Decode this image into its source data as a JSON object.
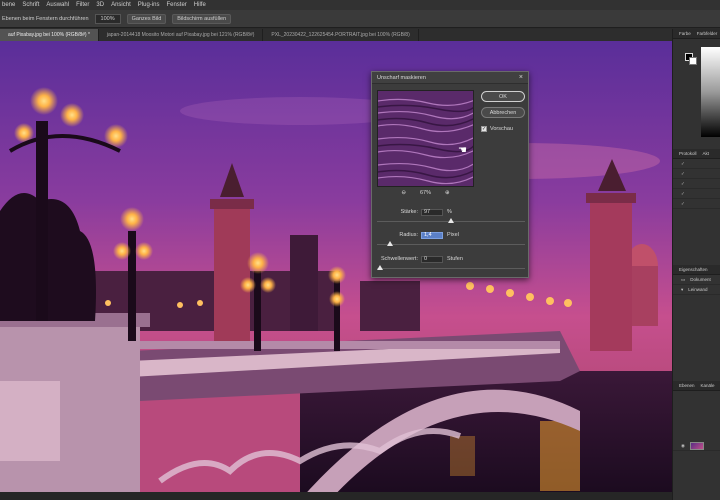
{
  "menubar": {
    "items": [
      "bene",
      "Schrift",
      "Auswahl",
      "Filter",
      "3D",
      "Ansicht",
      "Plug-ins",
      "Fenster",
      "Hilfe"
    ]
  },
  "options_bar": {
    "align_label": "Ebenen beim Fenstern durchführen",
    "zoom_value": "100%",
    "fit_button": "Ganzes Bild",
    "fill_button": "Bildschirm ausfüllen"
  },
  "tabs": [
    {
      "label": "auf Pixabay.jpg bei 100% (RGB/8#) *",
      "active": true
    },
    {
      "label": "japan-2014418 Moosito Motori auf Pixabay.jpg bei 121% (RGB/8#)",
      "active": false
    },
    {
      "label": "PXL_20230422_122625454.PORTRAIT.jpg bei 100% (RGB/8)",
      "active": false
    }
  ],
  "dialog": {
    "title": "Unscharf maskieren",
    "close_glyph": "×",
    "ok_label": "OK",
    "cancel_label": "Abbrechen",
    "preview_label": "Vorschau",
    "preview_checked": true,
    "zoom_level": "67%",
    "zoom_out": "⊖",
    "zoom_in": "⊕",
    "params": [
      {
        "label": "Stärke:",
        "value": "97",
        "unit": "%",
        "slider": 0.5,
        "active": false
      },
      {
        "label": "Radius:",
        "value": "1,4",
        "unit": "Pixel",
        "slider": 0.07,
        "active": true
      },
      {
        "label": "Schwellenwert:",
        "value": "0",
        "unit": "Stufen",
        "slider": 0.0,
        "active": false
      }
    ]
  },
  "right_panel": {
    "top_tabs": [
      "Farbe",
      "Farbfelder"
    ],
    "history_tabs": [
      "Protokoll",
      "Akt"
    ],
    "properties_title": "Eigenschaften",
    "properties_item": "Dokument",
    "layers_section": "Leinwand",
    "layers_tabs": [
      "Ebenen",
      "Kanäle"
    ]
  },
  "colors": {
    "sky_top": "#5a2e9a",
    "sky_bottom": "#c64f8e",
    "lamp": "#ffb347",
    "bridge": "#c6a0b8"
  }
}
